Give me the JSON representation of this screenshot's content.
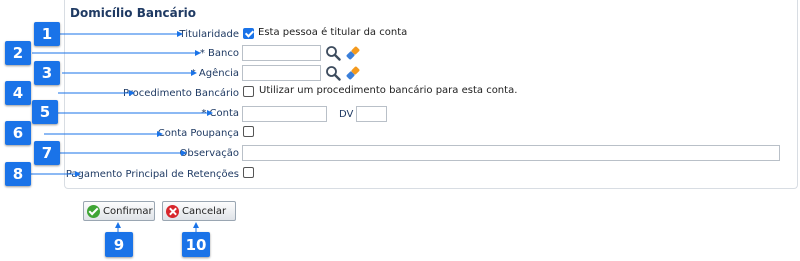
{
  "panel": {
    "title": "Domicílio Bancário"
  },
  "fields": {
    "titularidade": {
      "label": "Titularidade",
      "checkbox_text": "Esta pessoa é titular da conta",
      "checked": true
    },
    "banco": {
      "label": "* Banco",
      "value": ""
    },
    "agencia": {
      "label": "* Agência",
      "value": ""
    },
    "procedimento": {
      "label": "Procedimento Bancário",
      "checkbox_text": "Utilizar um procedimento bancário para esta conta.",
      "checked": false
    },
    "conta": {
      "label": "* Conta",
      "value": "",
      "dv_label": "DV",
      "dv_value": ""
    },
    "poupanca": {
      "label": "Conta Poupança",
      "checked": false
    },
    "observacao": {
      "label": "Observação",
      "value": ""
    },
    "retencoes": {
      "label": "Pagamento Principal de Retenções",
      "checked": false
    }
  },
  "icons": {
    "search": "search-icon",
    "eraser": "eraser-icon",
    "confirm": "check-circle-icon",
    "cancel": "x-circle-icon"
  },
  "buttons": {
    "confirm": "Confirmar",
    "cancel": "Cancelar"
  },
  "badges": [
    "1",
    "2",
    "3",
    "4",
    "5",
    "6",
    "7",
    "8",
    "9",
    "10"
  ],
  "colors": {
    "badge": "#1a73e8",
    "title": "#1f3a63",
    "confirm": "#3fa535",
    "cancel": "#d8262c"
  }
}
